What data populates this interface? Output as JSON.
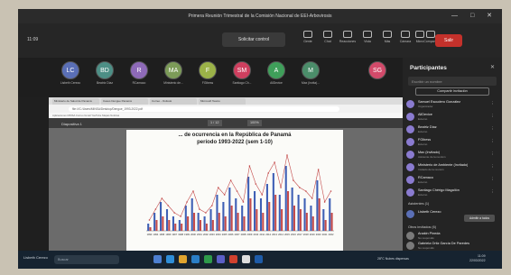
{
  "window": {
    "title": "Primera Reunión Trimestral de la Comisión Nacional de EEI-Arbovirosis",
    "controls": "— □ ✕"
  },
  "toolbar": {
    "clock": "11:09",
    "request_control": "Solicitar control",
    "buttons": [
      {
        "label": "Gente",
        "icon": "people-icon"
      },
      {
        "label": "Chat",
        "icon": "chat-icon"
      },
      {
        "label": "Reacciones",
        "icon": "reactions-icon"
      },
      {
        "label": "Vista",
        "icon": "view-icon"
      },
      {
        "label": "Más",
        "icon": "more-icon"
      },
      {
        "label": "Cámara",
        "icon": "camera-icon"
      },
      {
        "label": "Micro",
        "icon": "mic-icon"
      },
      {
        "label": "Compartir",
        "icon": "share-icon"
      }
    ],
    "leave": "Salir"
  },
  "avatars": [
    {
      "initials": "LC",
      "name": "Lisbeth Cerezo",
      "color": "#5a6fb6"
    },
    {
      "initials": "BD",
      "name": "Beatriz Díaz",
      "color": "#4d8f86"
    },
    {
      "initials": "R",
      "name": "RCamaco",
      "color": "#8e6ab8"
    },
    {
      "initials": "MA",
      "name": "Ministerio de...",
      "color": "#7c9b58"
    },
    {
      "initials": "F",
      "name": "FGlbess",
      "color": "#9bb248"
    },
    {
      "initials": "SM",
      "name": "Santiago Ch...",
      "color": "#cf3f5f"
    },
    {
      "initials": "A",
      "name": "AllDevice",
      "color": "#3f9f5a"
    },
    {
      "initials": "M",
      "name": "Max (Invita)...",
      "color": "#4b8d6a"
    },
    {
      "initials": "SG",
      "name": "",
      "color": "#d24a6a"
    }
  ],
  "browser": {
    "tabs": [
      "Ministerio de Salud de Panamá",
      "Casos Dengue Panamá",
      "Correo - Outlook",
      "Microsoft Teams"
    ],
    "url": "file:///C:/Users/MINSA/Desktop/Dengue_1993-2022.pdf",
    "bookmarks": "Aplicaciones   MINSA   Correo   Gmail   YouTube   Mapas   Noticias",
    "pdf_name": "Diapositiva 1",
    "page_indicator": "1 / 12",
    "zoom": "100%"
  },
  "chart_data": {
    "type": "bar",
    "title": "... de ocurrencia en la República de Panamá",
    "subtitle": "período 1993-2022 (sem 1-10)",
    "xlabel": "",
    "ylabel": "",
    "categories": [
      "1993",
      "1994",
      "1995",
      "1996",
      "1997",
      "1998",
      "1999",
      "2000",
      "2001",
      "2002",
      "2003",
      "2004",
      "2005",
      "2006",
      "2007",
      "2008",
      "2009",
      "2010",
      "2011",
      "2012",
      "2013",
      "2014",
      "2015",
      "2016",
      "2017",
      "2018",
      "2019",
      "2020",
      "2021",
      "2022"
    ],
    "series": [
      {
        "values": [
          2,
          5,
          8,
          6,
          4,
          3,
          7,
          9,
          5,
          4,
          6,
          10,
          8,
          12,
          9,
          7,
          15,
          11,
          9,
          13,
          16,
          10,
          18,
          12,
          10,
          9,
          7,
          14,
          6,
          9
        ],
        "color": "#3e5fb5"
      },
      {
        "values": [
          1,
          3,
          4,
          3,
          2,
          2,
          4,
          5,
          3,
          2,
          3,
          5,
          4,
          7,
          5,
          4,
          9,
          6,
          5,
          8,
          10,
          6,
          11,
          7,
          6,
          5,
          4,
          9,
          3,
          5
        ],
        "color": "#c44b4b"
      }
    ],
    "line_values": [
      3,
      6,
      9,
      7,
      5,
      4,
      8,
      11,
      6,
      5,
      7,
      12,
      10,
      14,
      11,
      8,
      18,
      13,
      10,
      16,
      19,
      12,
      21,
      14,
      12,
      11,
      9,
      17,
      8,
      11
    ],
    "line_color": "#c44b4b",
    "ylim": [
      0,
      22
    ],
    "grid": false
  },
  "panel": {
    "title": "Participantes",
    "search_placeholder": "Escribir un nombre",
    "share_invite": "Compartir invitación",
    "participants": [
      {
        "name": "Samuel Escudero González",
        "role": "Organizador"
      },
      {
        "name": "AllDevice",
        "role": "Externo"
      },
      {
        "name": "Beatriz Díaz",
        "role": "Externo"
      },
      {
        "name": "FGlbess",
        "role": "Externo"
      },
      {
        "name": "Max (Invitado)",
        "role": "Asistente de la reunión"
      },
      {
        "name": "Ministerio de Ambiente (Invitado)",
        "role": "Invitado de la reunión"
      },
      {
        "name": "RCamaco",
        "role": "Externo"
      },
      {
        "name": "Santiago Chérigo Magallón",
        "role": "Externo"
      }
    ],
    "lobby_label": "Asistentes (1)",
    "lobby_person": "Lisbeth Cerezo",
    "admit_all": "Admitir a todos",
    "others_label": "Otros invitados (6)",
    "others": [
      {
        "name": "Anakin Pineda",
        "role": "No respondió"
      },
      {
        "name": "Gabriela Ortiz García De Paredes",
        "role": "No respondió"
      }
    ]
  },
  "taskbar": {
    "user": "Lisbeth Cerezo",
    "search": "Buscar",
    "weather": "28°C Nubes dispersas",
    "time": "11:09",
    "date": "22/03/2022"
  }
}
